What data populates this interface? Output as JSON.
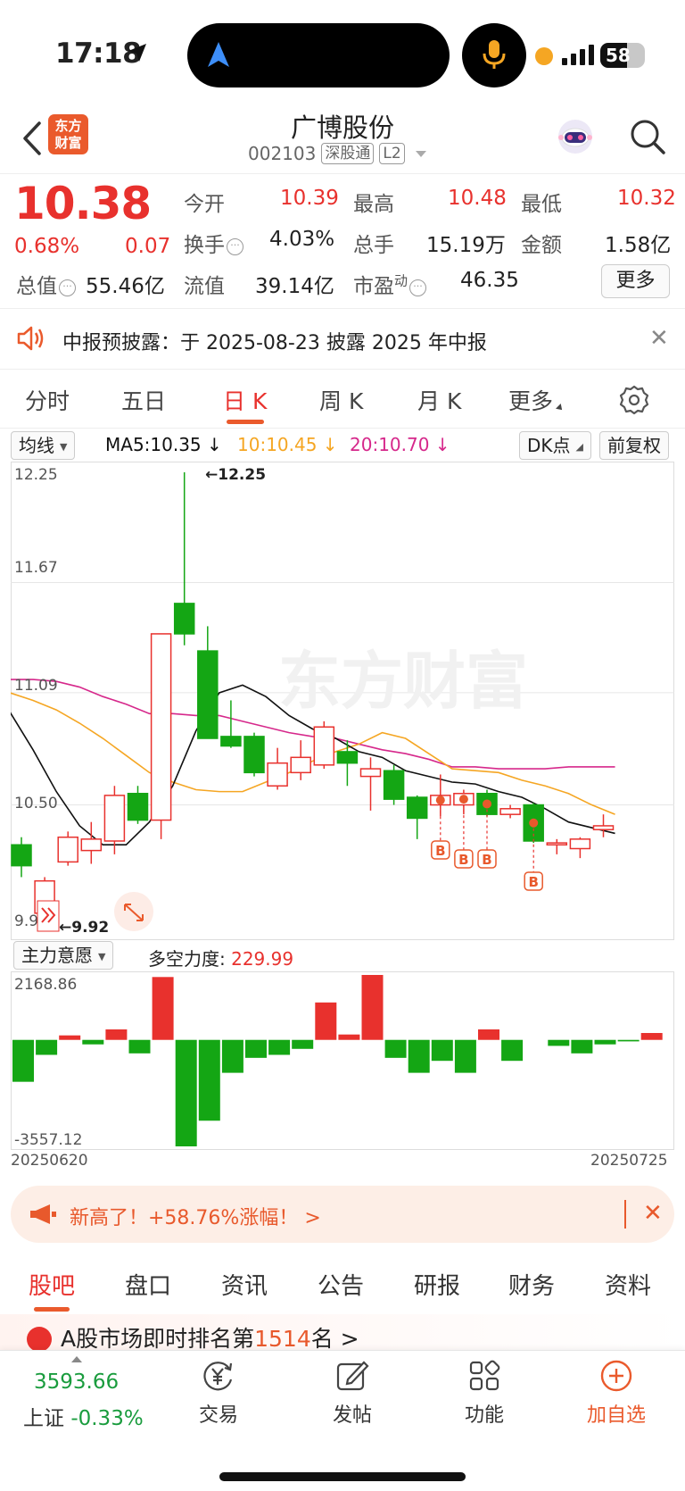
{
  "status": {
    "time": "17:18",
    "battery": "58"
  },
  "header": {
    "logo": "东方财富",
    "title": "广博股份",
    "code": "002103",
    "tag1": "深股通",
    "tag2": "L2"
  },
  "quote": {
    "price": "10.38",
    "pct": "0.68%",
    "chg": "0.07",
    "open_label": "今开",
    "open": "10.39",
    "high_label": "最高",
    "high": "10.48",
    "low_label": "最低",
    "low": "10.32",
    "turnover_label": "换手",
    "turnover": "4.03%",
    "volume_label": "总手",
    "volume": "15.19万",
    "amount_label": "金额",
    "amount": "1.58亿",
    "mktcap_label": "总值",
    "mktcap": "55.46亿",
    "float_label": "流值",
    "float": "39.14亿",
    "pe_label": "市盈",
    "pe_sup": "动",
    "pe": "46.35",
    "more": "更多"
  },
  "notice": {
    "text": "中报预披露：于 2025-08-23 披露 2025 年中报"
  },
  "ktabs": [
    "分时",
    "五日",
    "日 K",
    "周 K",
    "月 K",
    "更多"
  ],
  "indicators": {
    "ma_select": "均线",
    "ma5": "MA5:10.35 ↓",
    "ma10": "10:10.45 ↓",
    "ma20": "20:10.70 ↓",
    "dk": "DK点",
    "adjust": "前复权",
    "colors": {
      "ma5": "#111111",
      "ma10": "#f5a623",
      "ma20": "#d6288b",
      "up": "#e8312d",
      "down": "#14a614"
    }
  },
  "chart_data": [
    {
      "type": "candlestick",
      "ylim": [
        9.92,
        12.25
      ],
      "ytick_labels": [
        "12.25",
        "11.67",
        "11.09",
        "10.50",
        "9.92"
      ],
      "max_label": "←12.25",
      "min_label": "←9.92",
      "dates_start": "20250620",
      "dates_end": "20250725",
      "candles": [
        {
          "o": 10.29,
          "c": 10.18,
          "h": 10.33,
          "l": 10.12
        },
        {
          "o": 9.93,
          "c": 10.1,
          "h": 10.12,
          "l": 9.92
        },
        {
          "o": 10.2,
          "c": 10.33,
          "h": 10.36,
          "l": 10.18
        },
        {
          "o": 10.26,
          "c": 10.32,
          "h": 10.41,
          "l": 10.19
        },
        {
          "o": 10.31,
          "c": 10.55,
          "h": 10.6,
          "l": 10.24
        },
        {
          "o": 10.56,
          "c": 10.42,
          "h": 10.6,
          "l": 10.4
        },
        {
          "o": 10.42,
          "c": 11.4,
          "h": 11.4,
          "l": 10.32
        },
        {
          "o": 11.56,
          "c": 11.4,
          "h": 12.25,
          "l": 11.34
        },
        {
          "o": 11.31,
          "c": 10.85,
          "h": 11.44,
          "l": 10.85
        },
        {
          "o": 10.86,
          "c": 10.81,
          "h": 11.05,
          "l": 10.8
        },
        {
          "o": 10.86,
          "c": 10.67,
          "h": 10.88,
          "l": 10.65
        },
        {
          "o": 10.6,
          "c": 10.72,
          "h": 10.8,
          "l": 10.58
        },
        {
          "o": 10.67,
          "c": 10.75,
          "h": 10.84,
          "l": 10.63
        },
        {
          "o": 10.71,
          "c": 10.91,
          "h": 10.94,
          "l": 10.69
        },
        {
          "o": 10.78,
          "c": 10.72,
          "h": 10.84,
          "l": 10.6
        },
        {
          "o": 10.65,
          "c": 10.69,
          "h": 10.75,
          "l": 10.47
        },
        {
          "o": 10.68,
          "c": 10.53,
          "h": 10.71,
          "l": 10.5
        },
        {
          "o": 10.54,
          "c": 10.43,
          "h": 10.55,
          "l": 10.32
        },
        {
          "o": 10.5,
          "c": 10.55,
          "h": 10.66,
          "l": 10.44
        },
        {
          "o": 10.5,
          "c": 10.56,
          "h": 10.58,
          "l": 10.45
        },
        {
          "o": 10.56,
          "c": 10.45,
          "h": 10.58,
          "l": 10.44
        },
        {
          "o": 10.45,
          "c": 10.48,
          "h": 10.5,
          "l": 10.43
        },
        {
          "o": 10.5,
          "c": 10.31,
          "h": 10.51,
          "l": 10.3
        },
        {
          "o": 10.29,
          "c": 10.3,
          "h": 10.32,
          "l": 10.24
        },
        {
          "o": 10.27,
          "c": 10.32,
          "h": 10.33,
          "l": 10.22
        },
        {
          "o": 10.37,
          "c": 10.39,
          "h": 10.45,
          "l": 10.33
        }
      ],
      "ma5": [
        10.99,
        10.79,
        10.57,
        10.39,
        10.29,
        10.29,
        10.41,
        10.6,
        10.89,
        11.09,
        11.13,
        11.07,
        10.97,
        10.9,
        10.85,
        10.78,
        10.75,
        10.68,
        10.65,
        10.62,
        10.61,
        10.57,
        10.54,
        10.48,
        10.41,
        10.38,
        10.35
      ],
      "ma10": [
        11.09,
        11.05,
        11.0,
        10.93,
        10.85,
        10.76,
        10.67,
        10.62,
        10.58,
        10.57,
        10.57,
        10.62,
        10.67,
        10.73,
        10.78,
        10.82,
        10.88,
        10.85,
        10.77,
        10.69,
        10.68,
        10.67,
        10.63,
        10.6,
        10.56,
        10.5,
        10.45
      ],
      "ma20": [
        11.16,
        11.16,
        11.15,
        11.12,
        11.07,
        11.03,
        10.98,
        10.98,
        10.97,
        10.97,
        10.94,
        10.91,
        10.88,
        10.86,
        10.85,
        10.82,
        10.79,
        10.77,
        10.74,
        10.7,
        10.7,
        10.69,
        10.69,
        10.69,
        10.7,
        10.7,
        10.7
      ],
      "b_signals": [
        18,
        19,
        20,
        22
      ]
    },
    {
      "type": "bar",
      "title": "主力意愿",
      "label": "多空力度:",
      "value": "229.99",
      "ylim": [
        -3557.12,
        2168.86
      ],
      "ytick_labels": [
        "2168.86",
        "-3557.12"
      ],
      "values": [
        -1400,
        -500,
        150,
        -150,
        350,
        -450,
        2100,
        -3557.12,
        -2700,
        -1100,
        -600,
        -500,
        -300,
        1250,
        180,
        2168.86,
        -600,
        -1100,
        -700,
        -1100,
        350,
        -700,
        0,
        -200,
        -450,
        -150,
        -50,
        230
      ]
    }
  ],
  "sub_indicator": {
    "name": "主力意愿",
    "label": "多空力度:",
    "value": "229.99"
  },
  "banner": {
    "text": "新高了！+58.76%涨幅！ >"
  },
  "btabs": [
    "股吧",
    "盘口",
    "资讯",
    "公告",
    "研报",
    "财务",
    "资料"
  ],
  "rank": {
    "prefix": "A股市场即时排名第",
    "num": "1514",
    "suffix": "名 >"
  },
  "bottom_nav": {
    "index_value": "3593.66",
    "index_name": "上证",
    "index_pct": "-0.33%",
    "items": [
      "交易",
      "发帖",
      "功能",
      "加自选"
    ]
  }
}
